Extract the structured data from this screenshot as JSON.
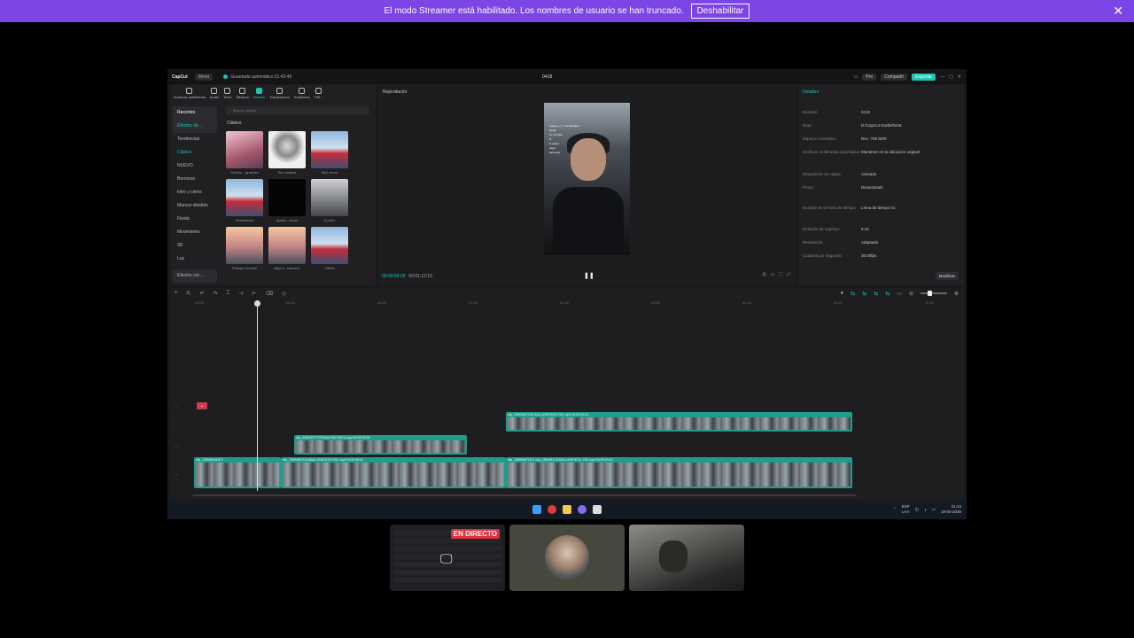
{
  "banner": {
    "message": "El modo Streamer está habilitado. Los nombres de usuario se han truncado.",
    "disable_label": "Deshabilitar",
    "close_icon": "close-icon"
  },
  "app": {
    "logo": "CapCut",
    "menu_label": "Menú",
    "autosave": "Guardado automático 21:43:46",
    "project_name": "0418",
    "pro_label": "Pro",
    "share_label": "Compartir",
    "export_label": "Exportar"
  },
  "left_panel": {
    "tabs": [
      {
        "label": "Archivos multimedia",
        "active": false
      },
      {
        "label": "Audio",
        "active": false
      },
      {
        "label": "Texto",
        "active": false
      },
      {
        "label": "Stickers",
        "active": false
      },
      {
        "label": "Efectos",
        "active": true
      },
      {
        "label": "Transiciones",
        "active": false
      },
      {
        "label": "Subtítulos",
        "active": false
      },
      {
        "label": "Filtr...",
        "active": false
      }
    ],
    "categories": [
      "Recortes",
      "Efectos de ...",
      "Tendencias",
      "Clásico",
      "NUEVO",
      "Borrosos",
      "Intro y cierre",
      "Marcos dividido",
      "Fiesta",
      "Movimiento",
      "3D",
      "Luz",
      "Efectos cor..."
    ],
    "search_placeholder": "Buscar efectos",
    "grid_title": "Clásico",
    "effects": [
      "Puntos ...grandes",
      "Sin cuadros",
      "Mini zoom",
      "Desenfocar",
      "Aparic...tenue",
      "A color",
      "Paisaje cerrado",
      "Baja a...solución",
      "Viñeta"
    ]
  },
  "player": {
    "title": "Reproductor",
    "current_time": "00:00:04:29",
    "total_time": "00:01:12:10",
    "video_text": "sofiaa_1_7 | intentándolo\nsinoiii\nen el fondo\nsí\nlo apoyo\nnego\n(amores)"
  },
  "details": {
    "title": "Detalles",
    "rows": [
      {
        "k": "Nombre:",
        "v": "0418"
      },
      {
        "k": "Ruta:",
        "v": "D:/CapCut Drafts/0418"
      },
      {
        "k": "Espacio cromático:",
        "v": "Rec. 709 SDR"
      },
      {
        "k": "Archivos multimedia importados:",
        "v": "Mantener en la ubicación original"
      },
      {
        "k": "Disposición de capas:",
        "v": "Activado"
      },
      {
        "k": "Proxy:",
        "v": "Desactivado"
      },
      {
        "k": "Nombre de la línea de tiempo:",
        "v": "Línea de tiempo 01"
      },
      {
        "k": "Relación de aspecto:",
        "v": "9:16"
      },
      {
        "k": "Resolución:",
        "v": "Adaptado"
      },
      {
        "k": "Cuadros por segundo:",
        "v": "30.00fps"
      }
    ],
    "modify_label": "Modificar"
  },
  "timeline": {
    "ruler": [
      "00:00",
      "00:10",
      "00:20",
      "00:30",
      "00:40",
      "00:50",
      "01:00",
      "01:10",
      "01:20"
    ],
    "clips": [
      {
        "label": "clip_2369484715H:AAA-1E8E3C0C-F5C.mp4  00:00:33:02"
      },
      {
        "label": "clip_2369437YTSFDAA4766Y3EEC.mp4  00:00:20:02"
      },
      {
        "label": "clip_2369484411F2"
      },
      {
        "label": "clip_2369468711S4AA9-1E8E3C0C-F5C.mp4  00:00:36:02"
      },
      {
        "label": "clip_2369484711F1  clip_2369484711SAA-1E8E3C0C-F5C.mp4  00:00:29:02"
      }
    ]
  },
  "taskbar": {
    "lang": "ESP\nLAA",
    "time": "21:43",
    "date": "18-04-2026"
  },
  "call": {
    "live_label": "EN DIRECTO"
  }
}
